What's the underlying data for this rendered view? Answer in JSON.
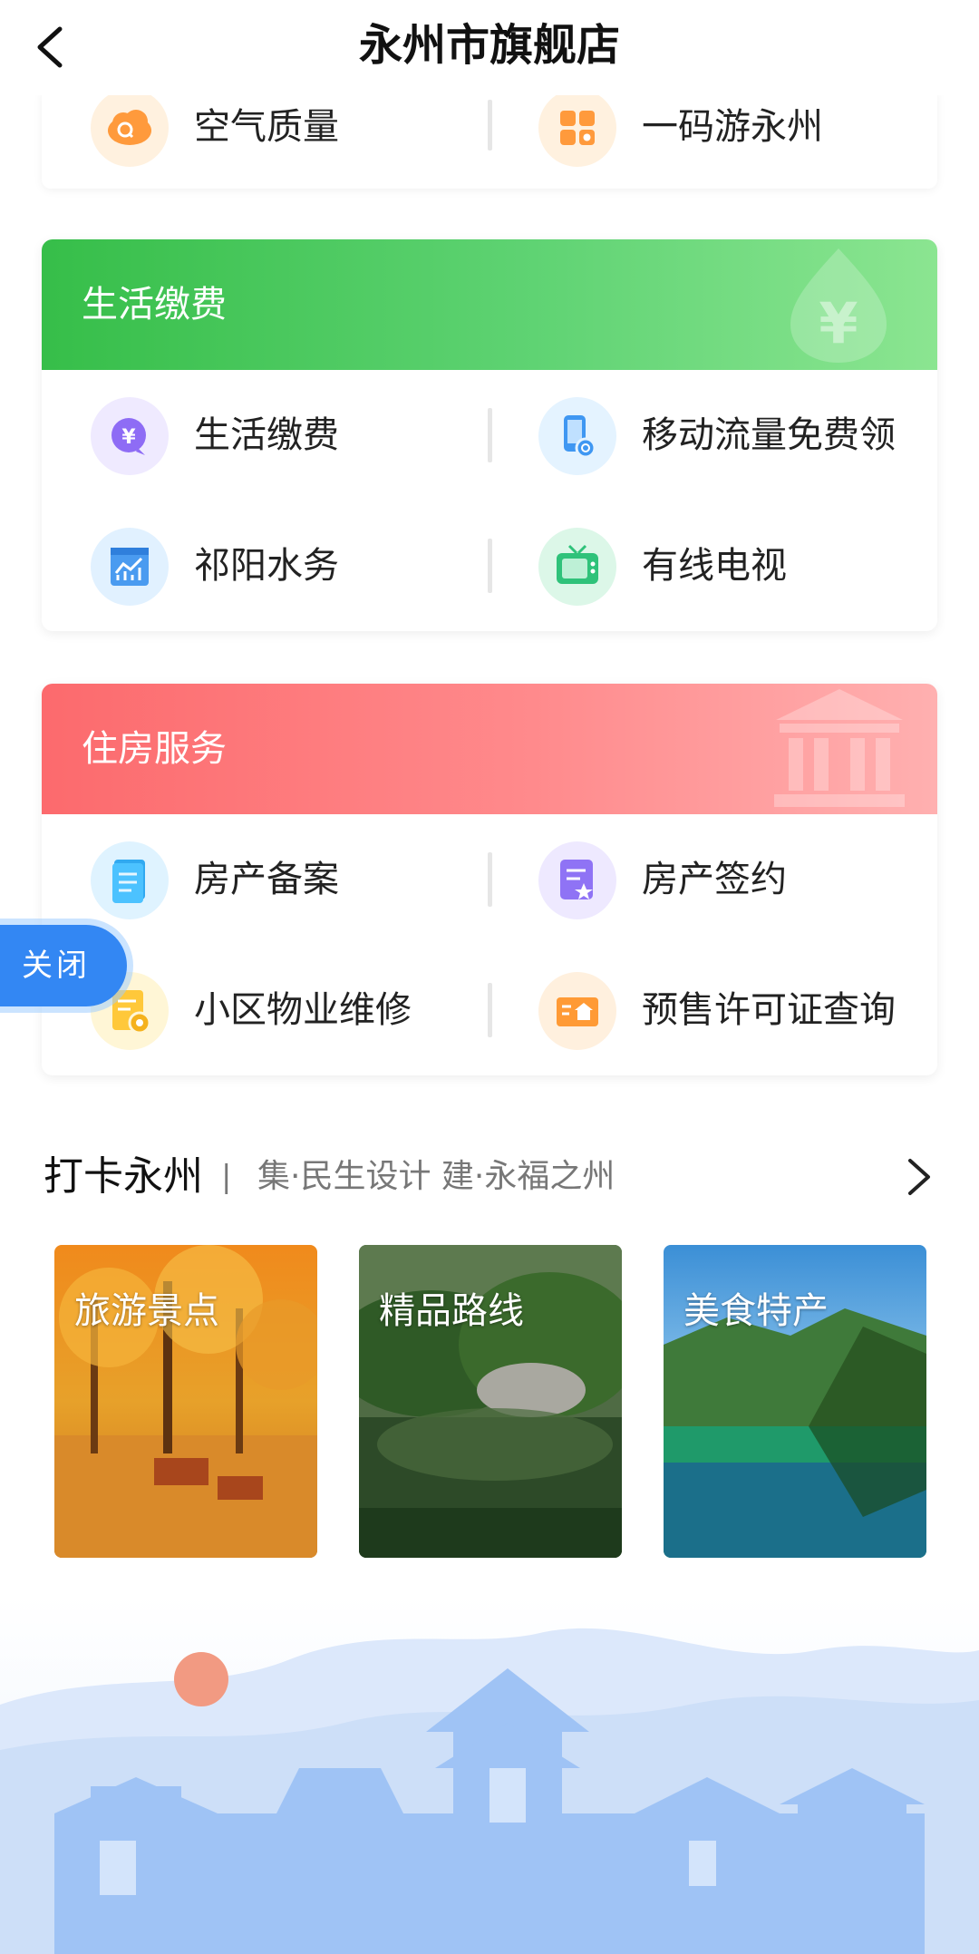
{
  "header": {
    "title": "永州市旗舰店"
  },
  "top_card": {
    "items": [
      {
        "label": "空气质量",
        "icon": "air-quality-icon"
      },
      {
        "label": "一码游永州",
        "icon": "apps-grid-icon"
      }
    ]
  },
  "life_payment": {
    "title": "生活缴费",
    "header_icon": "yuan-drop-icon",
    "items": [
      {
        "label": "生活缴费",
        "icon": "yuan-bubble-icon"
      },
      {
        "label": "移动流量免费领",
        "icon": "mobile-data-icon"
      },
      {
        "label": "祁阳水务",
        "icon": "water-chart-icon"
      },
      {
        "label": "有线电视",
        "icon": "tv-icon"
      }
    ]
  },
  "housing": {
    "title": "住房服务",
    "header_icon": "building-icon",
    "items": [
      {
        "label": "房产备案",
        "icon": "document-icon"
      },
      {
        "label": "房产签约",
        "icon": "contract-star-icon"
      },
      {
        "label": "小区物业维修",
        "icon": "repair-doc-icon"
      },
      {
        "label": "预售许可证查询",
        "icon": "license-house-icon"
      }
    ]
  },
  "float_button": {
    "label": "关闭"
  },
  "checkin": {
    "title": "打卡永州",
    "divider": "|",
    "subtitle": "集·民生设计 建·永福之州",
    "tiles": [
      {
        "label": "旅游景点"
      },
      {
        "label": "精品路线"
      },
      {
        "label": "美食特产"
      }
    ]
  },
  "colors": {
    "green_header": "#36be49",
    "red_header": "#fc6a6d",
    "close_button": "#3387f3",
    "scenery_blue": "#9fc3f5"
  }
}
